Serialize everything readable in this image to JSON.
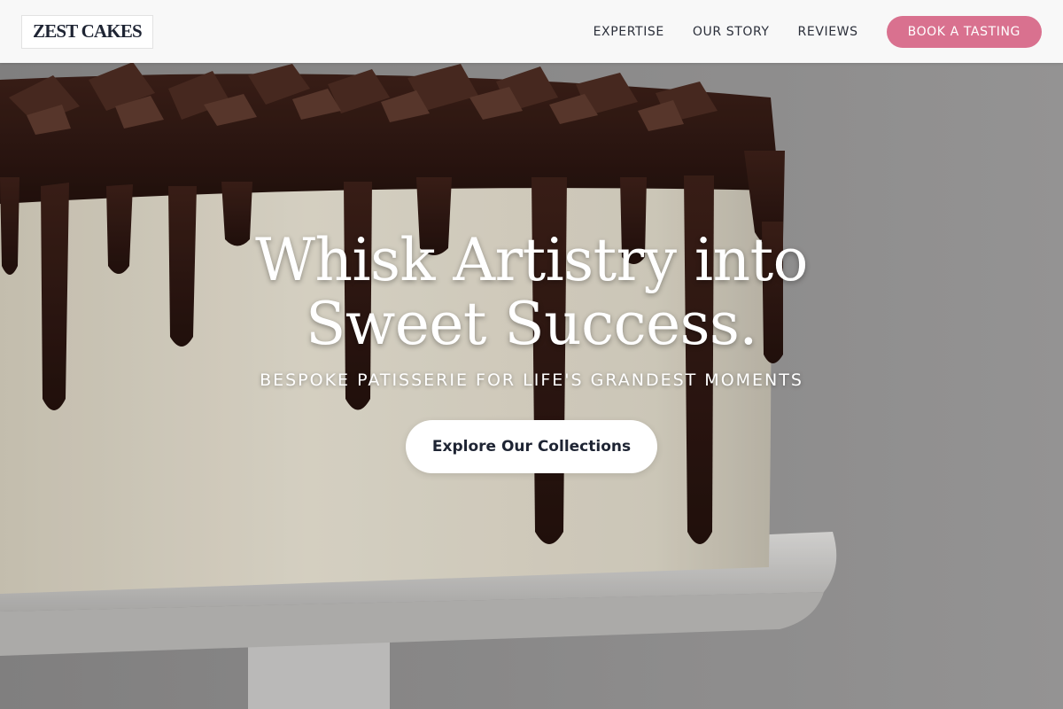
{
  "brand": {
    "name": "ZEST CAKES"
  },
  "nav": {
    "links": [
      {
        "label": "EXPERTISE"
      },
      {
        "label": "OUR STORY"
      },
      {
        "label": "REVIEWS"
      }
    ],
    "cta_label": "BOOK A TASTING"
  },
  "hero": {
    "title": "Whisk Artistry into\nSweet Success.",
    "subtitle": "BESPOKE PATISSERIE FOR LIFE'S GRANDEST MOMENTS",
    "button_label": "Explore Our Collections"
  },
  "colors": {
    "accent": "#d9718f",
    "navbar_bg": "#f8f8f8",
    "text_dark": "#1e2433",
    "chocolate": "#2a140f",
    "frosting": "#ebe6d6",
    "backdrop": "#9a9a9a"
  }
}
